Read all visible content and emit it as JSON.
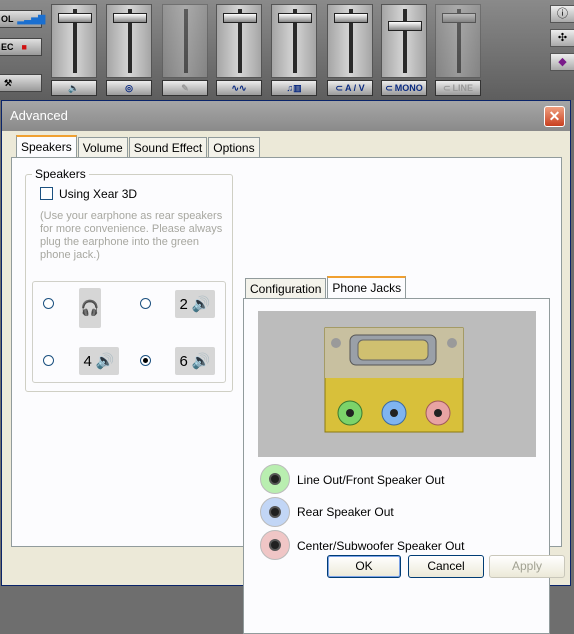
{
  "mixer": {
    "left_buttons": [
      {
        "label": "OL",
        "icon": "bars-icon"
      },
      {
        "label": "EC",
        "icon": "record-icon"
      },
      {
        "label": "",
        "icon": "tools-icon"
      }
    ],
    "channels": [
      {
        "label": "",
        "icon": "speaker-icon"
      },
      {
        "label": "",
        "icon": "cd-icon"
      },
      {
        "label": "",
        "icon": "microphone-icon"
      },
      {
        "label": "",
        "icon": "wave-icon"
      },
      {
        "label": "",
        "icon": "midi-icon"
      },
      {
        "label": "A / V",
        "icon": "av-icon"
      },
      {
        "label": "MONO",
        "icon": "mono-icon"
      },
      {
        "label": "LINE",
        "icon": "line-icon"
      }
    ],
    "right_buttons": [
      {
        "icon": "info-icon",
        "glyph": "ⓘ"
      },
      {
        "icon": "settings-icon",
        "glyph": "✣"
      },
      {
        "icon": "skin-icon",
        "glyph": "◆"
      }
    ]
  },
  "dialog": {
    "title": "Advanced",
    "close_glyph": "✕",
    "tabs": [
      "Speakers",
      "Volume",
      "Sound Effect",
      "Options"
    ],
    "speakers_group": {
      "label": "Speakers",
      "xear_checkbox": {
        "label": "Using Xear 3D",
        "checked": false
      },
      "hint": "(Use your earphone as rear speakers for more convenience. Please always plug the earphone into the green phone jack.)",
      "options": [
        {
          "label": "",
          "icon": "headphones-icon",
          "checked": false
        },
        {
          "label": "2",
          "icon": "speaker-icon",
          "checked": false
        },
        {
          "label": "4",
          "icon": "speaker-icon",
          "checked": false
        },
        {
          "label": "6",
          "icon": "speaker-icon",
          "checked": true
        }
      ]
    },
    "right_tabs": [
      "Configuration",
      "Phone Jacks"
    ],
    "jacks": [
      {
        "label": "Line Out/Front Speaker Out",
        "color": "#7cd36a"
      },
      {
        "label": "Rear Speaker Out",
        "color": "#7fb4f0"
      },
      {
        "label": "Center/Subwoofer Speaker Out",
        "color": "#e8a3a3"
      }
    ],
    "buttons": {
      "ok": "OK",
      "cancel": "Cancel",
      "apply": "Apply"
    }
  }
}
